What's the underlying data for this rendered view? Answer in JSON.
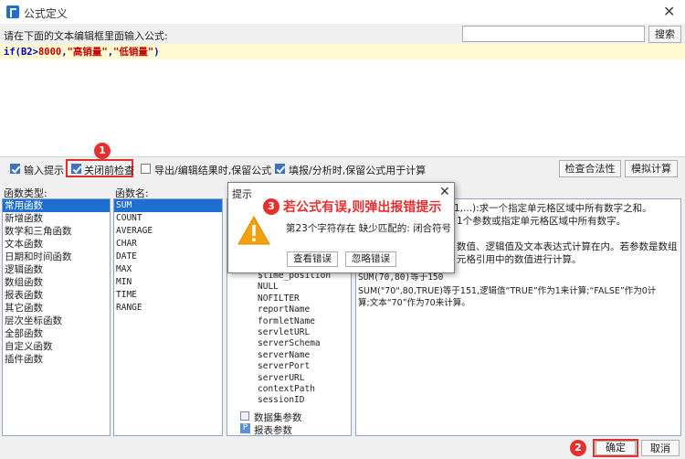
{
  "window": {
    "title": "公式定义"
  },
  "prompt_label": "请在下面的文本编辑框里面输入公式:",
  "search": {
    "button": "搜索"
  },
  "formula": {
    "fn": "if(B2>",
    "num": "8000",
    "sep1": ",",
    "s1": "\"高销量\"",
    "sep2": ",",
    "s2": "\"低销量\"",
    "end": ")"
  },
  "options": {
    "input_hint": "输入提示",
    "check_on_close": "关闭前检查",
    "export_keep": "导出/编辑结果时,保留公式",
    "fill_keep": "填报/分析时,保留公式用于计算",
    "check_button": "检查合法性",
    "simulate_button": "模拟计算"
  },
  "headers": {
    "types": "函数类型:",
    "names": "函数名:"
  },
  "function_types": [
    "常用函数",
    "新增函数",
    "数学和三角函数",
    "文本函数",
    "日期和时间函数",
    "逻辑函数",
    "数组函数",
    "报表函数",
    "其它函数",
    "层次坐标函数",
    "全部函数",
    "自定义函数",
    "插件函数"
  ],
  "function_names": [
    "SUM",
    "COUNT",
    "AVERAGE",
    "CHAR",
    "DATE",
    "MAX",
    "MIN",
    "TIME",
    "RANGE"
  ],
  "params": [
    "$time_position",
    "NULL",
    "NOFILTER",
    "reportName",
    "formletName",
    "servletURL",
    "serverSchema",
    "serverName",
    "serverPort",
    "serverURL",
    "contextPath",
    "sessionID"
  ],
  "param_groups": [
    "数据集参数",
    "报表参数"
  ],
  "description": {
    "line1": "1,...):求一个指定单元格区域中所有数字之和。",
    "line2": "1个参数或指定单元格区域中所有数字。",
    "line3": "数值、逻辑值及文本表达式计算在内。若参数是数组",
    "line4": "元格引用中的数值进行计算。",
    "line5": "SUM(70,80)等于150",
    "line6": "SUM(\"70\",80,TRUE)等于151,逻辑值“TRUE”作为1来计算;“FALSE”作为0计",
    "line7": "算;文本“70”作为70来计算。"
  },
  "dialog": {
    "title": "提示",
    "message": "第23个字符存在 缺少匹配的: 闭合符号",
    "view_button": "查看错误",
    "ignore_button": "忽略错误"
  },
  "annotations": {
    "badge1": "1",
    "badge2": "2",
    "badge3": "3",
    "callout": "若公式有误,则弹出报错提示"
  },
  "footer": {
    "ok": "确定",
    "cancel": "取消"
  },
  "colors": {
    "accent": "#1e6fd0",
    "annotation_red": "#e53030",
    "formula_keyword": "#0000c0",
    "formula_string": "#c00000"
  }
}
